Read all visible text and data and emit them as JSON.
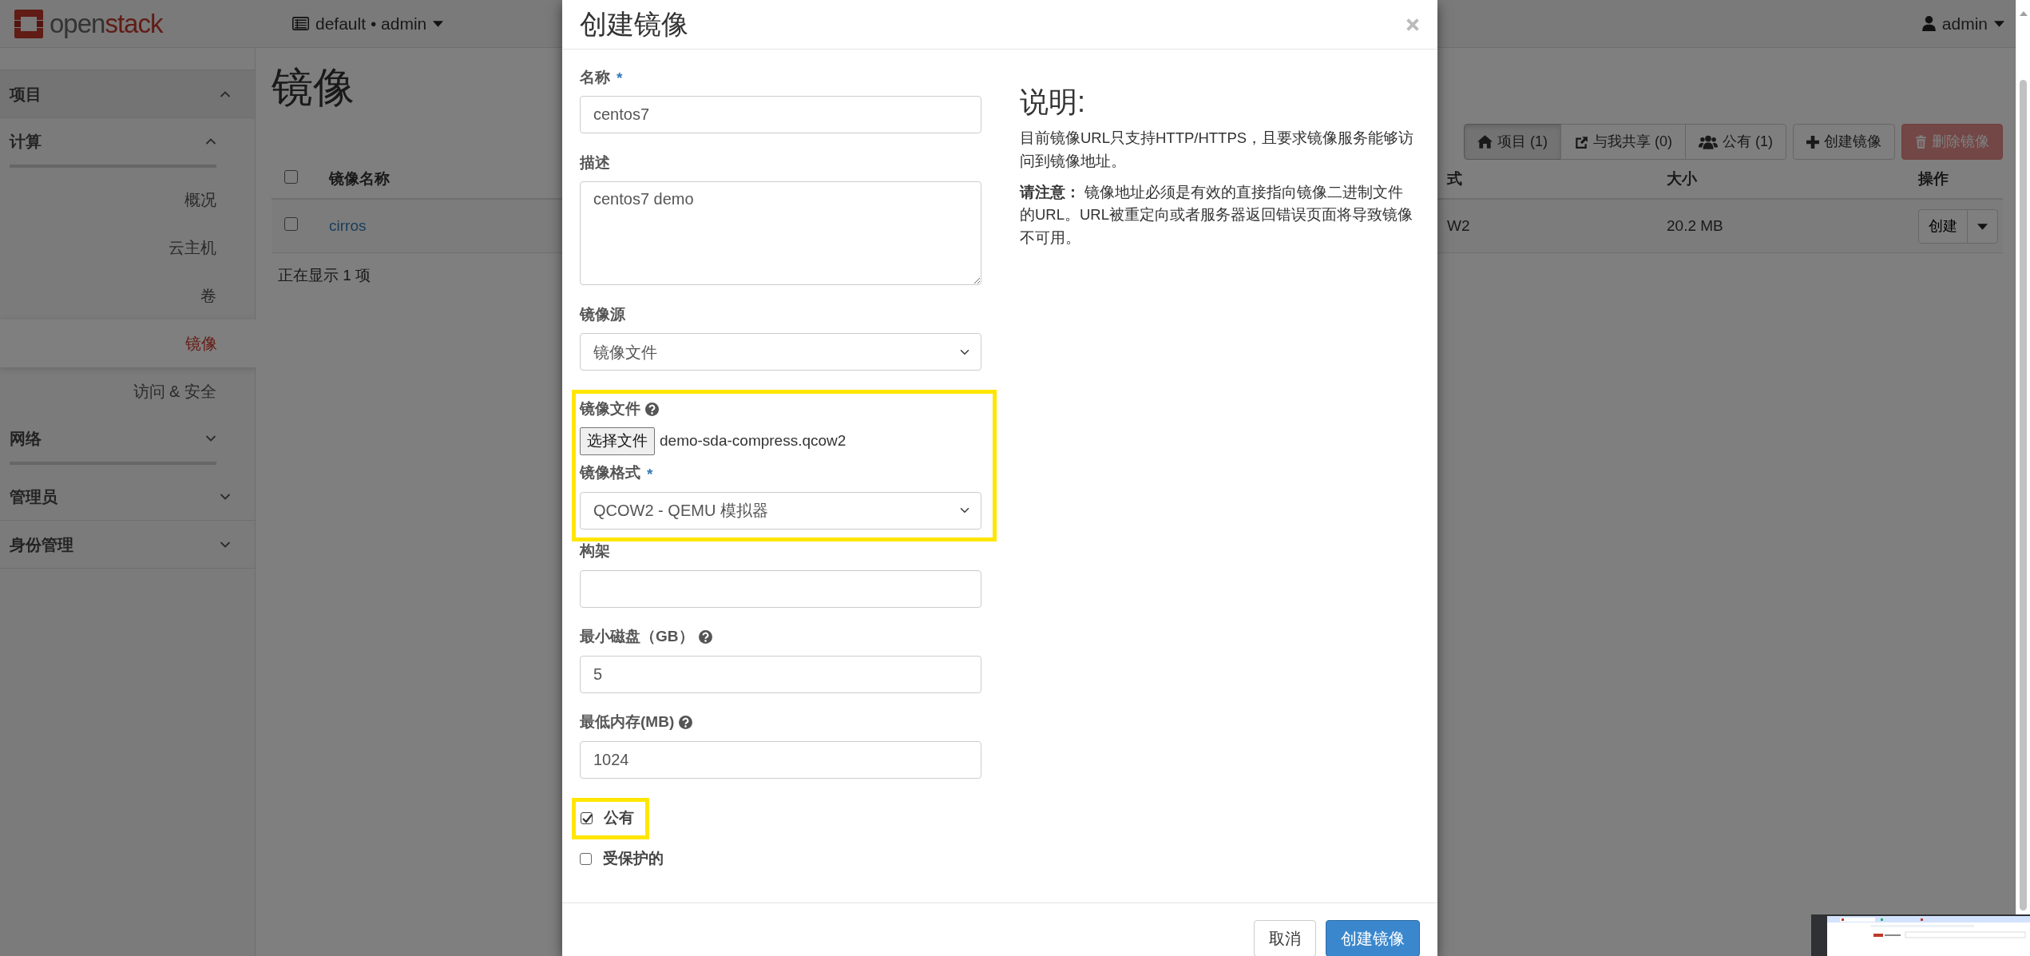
{
  "header": {
    "logo": "open**stack**",
    "project_menu": "default • admin",
    "user_menu": "admin"
  },
  "sidebar": {
    "items": [
      {
        "label": "项目",
        "expanded": true,
        "children": [
          {
            "label": "计算",
            "expanded": true,
            "children": [
              {
                "label": "概况",
                "selected": false
              },
              {
                "label": "云主机",
                "selected": false
              },
              {
                "label": "卷",
                "selected": false
              },
              {
                "label": "镜像",
                "selected": true
              },
              {
                "label": "访问 & 安全",
                "selected": false
              }
            ]
          },
          {
            "label": "网络",
            "expanded": false
          }
        ]
      },
      {
        "label": "管理员",
        "expanded": false
      },
      {
        "label": "身份管理",
        "expanded": false
      }
    ]
  },
  "page": {
    "title": "镜像",
    "filters": [
      {
        "label": "项目 (1)",
        "selected": true
      },
      {
        "label": "与我共享 (0)",
        "selected": false
      },
      {
        "label": "公有 (1)",
        "selected": false
      }
    ],
    "actions": [
      {
        "label": "创建镜像",
        "kind": "default",
        "disabled": false
      },
      {
        "label": "删除镜像",
        "kind": "danger",
        "disabled": true
      }
    ],
    "table": {
      "select_all": false,
      "columns": [
        {
          "label": "镜像名称"
        },
        {
          "label": "式"
        },
        {
          "label": "大小"
        },
        {
          "label": "操作"
        }
      ],
      "rows": [
        {
          "checked": false,
          "cells": [
            "cirros",
            "W2",
            "20.2 MB"
          ],
          "action": "创建"
        }
      ]
    },
    "footer_text": "正在显示 1 项"
  },
  "modal": {
    "title": "创建镜像",
    "fields": [
      {
        "kind": "text",
        "label": "名称",
        "required_mark": "*",
        "value": "centos7",
        "highlighted": false
      },
      {
        "kind": "textarea",
        "label": "描述",
        "value": "centos7 demo",
        "highlighted": false
      },
      {
        "kind": "select",
        "label": "镜像源",
        "value": "镜像文件",
        "highlighted": false
      },
      {
        "kind": "file",
        "label": "镜像文件",
        "help": true,
        "button": "选择文件",
        "filename": "demo-sda-compress.qcow2",
        "highlighted": true
      },
      {
        "kind": "select",
        "label": "镜像格式",
        "required_mark": "*",
        "value": "QCOW2 - QEMU 模拟器",
        "highlighted": true
      },
      {
        "kind": "text",
        "label": "构架",
        "highlighted": false
      },
      {
        "kind": "text",
        "label": "最小磁盘（GB）",
        "help": true,
        "value": "5",
        "highlighted": false
      },
      {
        "kind": "text",
        "label": "最低内存(MB)",
        "help": true,
        "value": "1024",
        "highlighted": false
      },
      {
        "kind": "checkbox",
        "label": "公有",
        "checked": true,
        "highlighted": true
      },
      {
        "kind": "checkbox",
        "label": "受保护的",
        "checked": false,
        "highlighted": false
      }
    ],
    "help_title": "说明:",
    "help_paragraphs": [
      "目前镜像URL只支持HTTP/HTTPS，且要求镜像服务能够访问到镜像地址。",
      "**请注意：**  镜像地址必须是有效的直接指向镜像二进制文件的URL。URL被重定向或者服务器返回错误页面将导致镜像不可用。"
    ],
    "buttons": [
      {
        "label": "取消",
        "kind": "default"
      },
      {
        "label": "创建镜像",
        "kind": "primary"
      }
    ]
  }
}
